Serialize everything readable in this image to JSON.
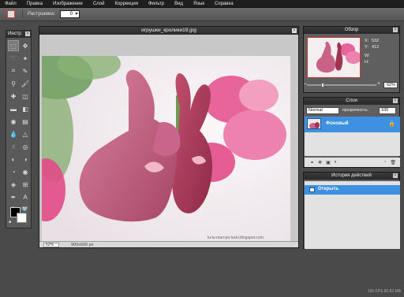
{
  "menu": [
    "Файл",
    "Правка",
    "Изображение",
    "Слой",
    "Коррекция",
    "Фильтр",
    "Вид",
    "Язык",
    "Справка"
  ],
  "options": {
    "feather_label": "Растушевка:",
    "feather_value": "0"
  },
  "tools": {
    "title": "Инстр.",
    "close": "×",
    "icons": [
      "marquee-icon",
      "move-icon",
      "lasso-icon",
      "wand-icon",
      "crop-icon",
      "pencil-icon",
      "stamp-icon",
      "brush-icon",
      "heal-icon",
      "eraser-icon",
      "rectangle-icon",
      "eraser2-icon",
      "bucket-icon",
      "gradient-icon",
      "blur-icon",
      "sharpen-icon",
      "smudge-icon",
      "sponge-icon",
      "dodge-icon",
      "burn-icon",
      "eye-icon",
      "redeye-icon",
      "transform-icon",
      "resize-icon",
      "eyedropper-icon",
      "text-icon",
      "hand-icon",
      "zoom-icon"
    ],
    "glyphs": [
      "⬚",
      "✥",
      "➰",
      "✦",
      "⌗",
      "✎",
      "⚲",
      "🖌",
      "✚",
      "◫",
      "▬",
      "◧",
      "◉",
      "▤",
      "💧",
      "△",
      "☝",
      "◎",
      "◐",
      "◑",
      "◔",
      "◉",
      "◈",
      "⊞",
      "✒",
      "A",
      "✋",
      "🔍"
    ]
  },
  "document": {
    "title": "игрушки_кролики19.jpg",
    "close": "×",
    "zoom": "62",
    "zoom_unit": "%",
    "dimensions": "900x600 px",
    "watermark": "lu-lu-mari-po-lucki.blogspot.com"
  },
  "navigator": {
    "title": "Обзор",
    "close": "×",
    "x_label": "X:",
    "x_value": "532",
    "y_label": "Y:",
    "y_value": "412",
    "w_label": "W:",
    "h_label": "H:",
    "zoom_value": "62",
    "zoom_unit": "%",
    "minus": "–",
    "plus": "+",
    "zoom_fraction": 0.22
  },
  "layers": {
    "title": "Слои",
    "close": "×",
    "mode": "Normal",
    "opacity_label": "прозрачность:",
    "opacity_value": "100",
    "layer_name": "Фоновый",
    "lock": "🔒"
  },
  "history": {
    "title": "История действий",
    "close": "×",
    "item": "Открыть"
  },
  "fps": "165 FPS 80.82 MB",
  "colors": {
    "accent": "#3e90e0",
    "fg": "#000000",
    "bg": "#ffffff"
  }
}
